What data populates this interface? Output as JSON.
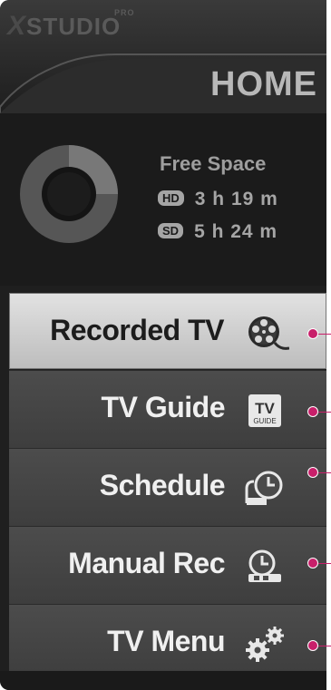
{
  "brand": {
    "x": "X",
    "studio": "STUDIO",
    "pro": "PRO"
  },
  "header": {
    "title": "HOME"
  },
  "space": {
    "label": "Free Space",
    "hd_badge": "HD",
    "hd_value": "3 h 19 m",
    "sd_badge": "SD",
    "sd_value": "5 h 24 m"
  },
  "menu": {
    "items": [
      {
        "label": "Recorded TV",
        "icon": "film-reel-icon",
        "selected": true
      },
      {
        "label": "TV Guide",
        "icon": "tv-guide-icon",
        "selected": false
      },
      {
        "label": "Schedule",
        "icon": "clock-schedule-icon",
        "selected": false
      },
      {
        "label": "Manual Rec",
        "icon": "manual-record-icon",
        "selected": false
      },
      {
        "label": "TV Menu",
        "icon": "gears-icon",
        "selected": false
      }
    ]
  },
  "colors": {
    "accent": "#c81f6a",
    "panel": "#1f1f1f",
    "selected": "#d6d6d6"
  }
}
